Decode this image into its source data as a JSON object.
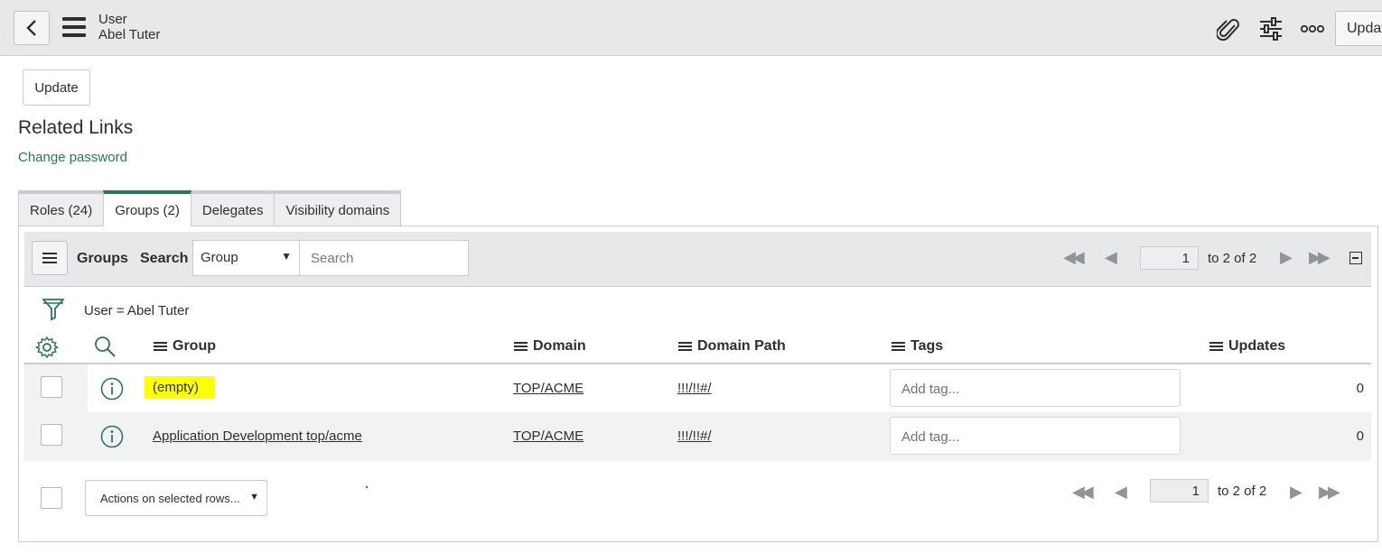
{
  "header": {
    "record_type": "User",
    "record_name": "Abel Tuter",
    "update_label": "Update"
  },
  "form": {
    "update_label": "Update",
    "related_links_title": "Related Links",
    "change_password_label": "Change password"
  },
  "tabs": [
    {
      "label": "Roles (24)",
      "active": false
    },
    {
      "label": "Groups (2)",
      "active": true
    },
    {
      "label": "Delegates",
      "active": false
    },
    {
      "label": "Visibility domains",
      "active": false
    }
  ],
  "list": {
    "title": "Groups",
    "search_label": "Search",
    "search_field": "Group",
    "search_placeholder": "Search",
    "page": "1",
    "page_of": "to 2 of 2",
    "filter_text": "User = Abel Tuter",
    "columns": [
      "Group",
      "Domain",
      "Domain Path",
      "Tags",
      "Updates"
    ],
    "rows": [
      {
        "group": "(empty)",
        "group_highlighted": true,
        "domain": "TOP/ACME",
        "domain_path": "!!!/!!#/",
        "tag_placeholder": "Add tag...",
        "updates": "0"
      },
      {
        "group": "Application Development top/acme",
        "group_highlighted": false,
        "domain": "TOP/ACME",
        "domain_path": "!!!/!!#/",
        "tag_placeholder": "Add tag...",
        "updates": "0"
      }
    ],
    "footer": {
      "actions_label": "Actions on selected rows...",
      "page": "1",
      "page_of": "to 2 of 2"
    }
  },
  "colors": {
    "accent": "#2c7364",
    "header_bg": "#e6e8ea",
    "highlight": "#ffff00"
  },
  "icons": [
    "back-icon",
    "menu-icon",
    "paperclip-icon",
    "settings-sliders-icon",
    "more-icon",
    "list-menu-icon",
    "first-page-icon",
    "prev-page-icon",
    "next-page-icon",
    "last-page-icon",
    "collapse-icon",
    "filter-icon",
    "gear-icon",
    "search-icon",
    "info-icon"
  ]
}
